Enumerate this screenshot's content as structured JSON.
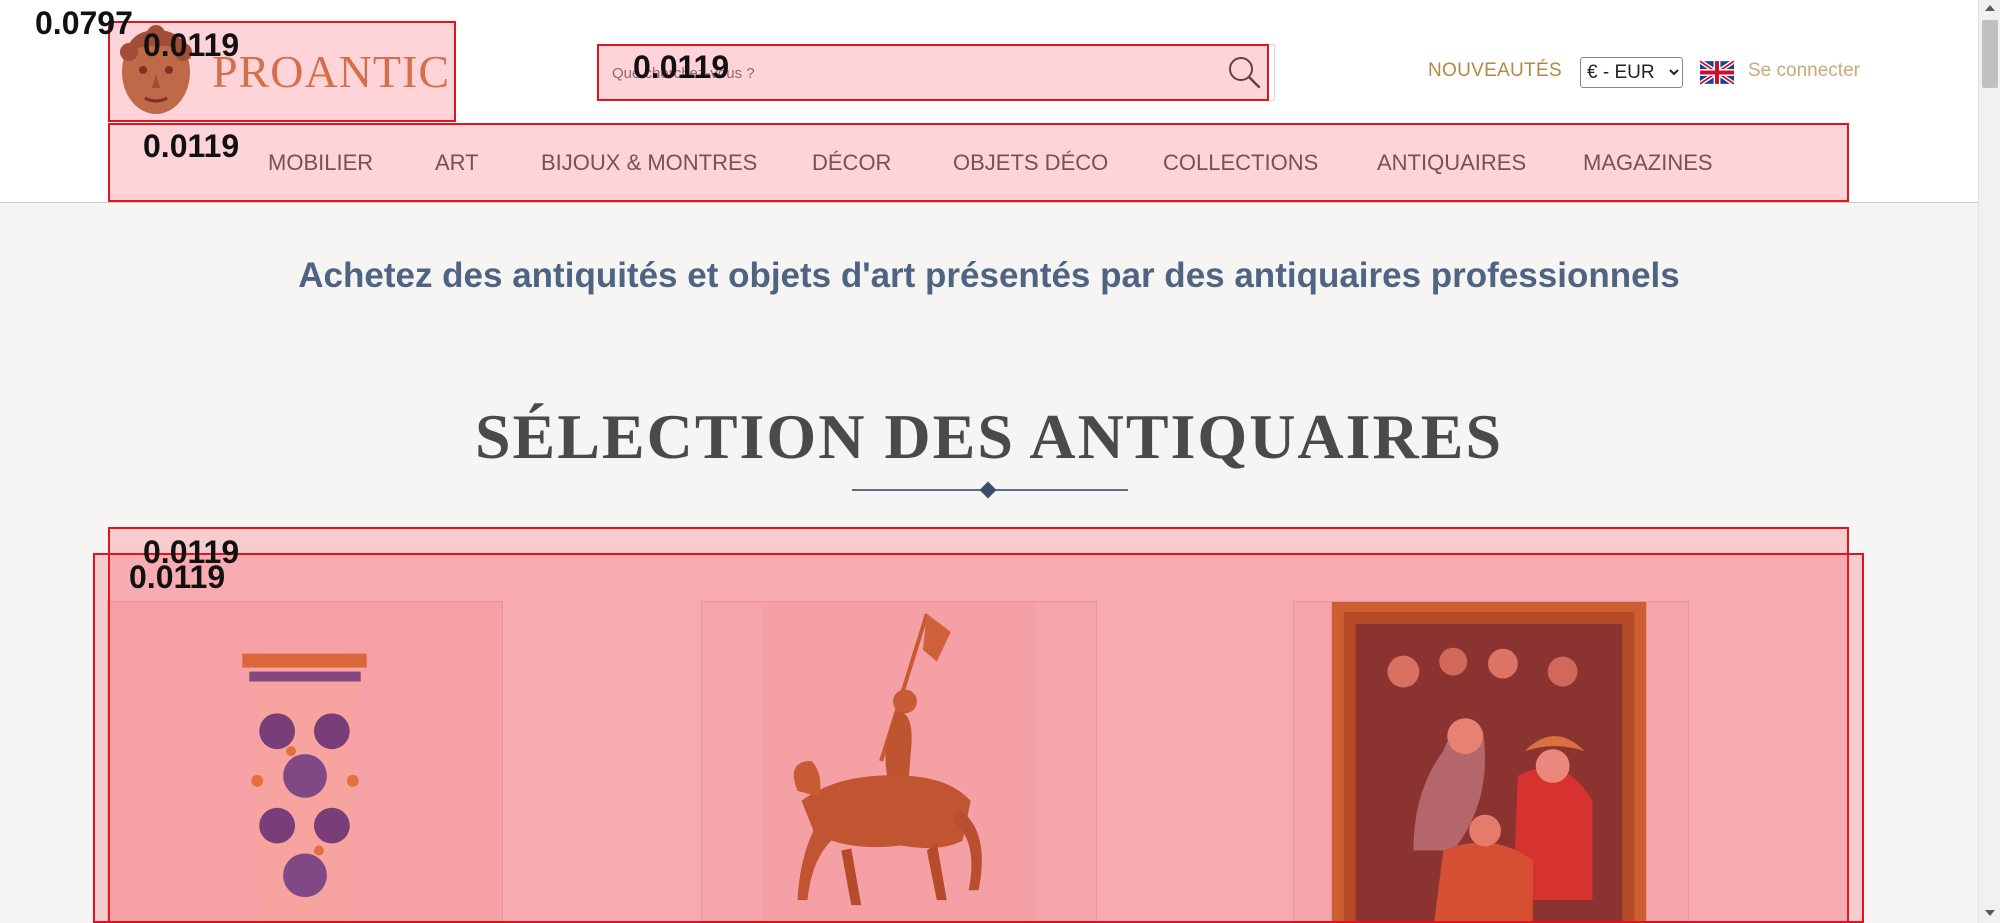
{
  "header": {
    "logo_text": "PROANTIC",
    "search": {
      "placeholder": "Que cherchez-vous ?",
      "value": ""
    },
    "nouveautes_label": "NOUVEAUTÉS",
    "currency": {
      "selected": "€ - EUR",
      "options": [
        "€ - EUR"
      ]
    },
    "language_flag": "uk-flag-icon",
    "login_label": "Se connecter"
  },
  "nav": {
    "items": [
      {
        "label": "MOBILIER"
      },
      {
        "label": "ART"
      },
      {
        "label": "BIJOUX & MONTRES"
      },
      {
        "label": "DÉCOR"
      },
      {
        "label": "OBJETS DÉCO"
      },
      {
        "label": "COLLECTIONS"
      },
      {
        "label": "ANTIQUAIRES"
      },
      {
        "label": "MAGAZINES"
      }
    ]
  },
  "main": {
    "tagline": "Achetez des antiquités et objets d'art présentés par des antiquaires professionnels",
    "section_title": "SÉLECTION DES ANTIQUAIRES",
    "cards": [
      {
        "image": "majolica-albarello-vase"
      },
      {
        "image": "bronze-equestrian-statue"
      },
      {
        "image": "framed-religious-painting"
      }
    ]
  },
  "overlays": {
    "labels": [
      "0.0797",
      "0.0119",
      "0.0119",
      "0.0119",
      "0.0119",
      "0.0119"
    ],
    "color": "#e0141e"
  },
  "colors": {
    "brand_copper": "#c9814f",
    "accent_gold": "#b08a44",
    "tagline_blue": "#4f6483",
    "background": "#f6f5f3"
  }
}
